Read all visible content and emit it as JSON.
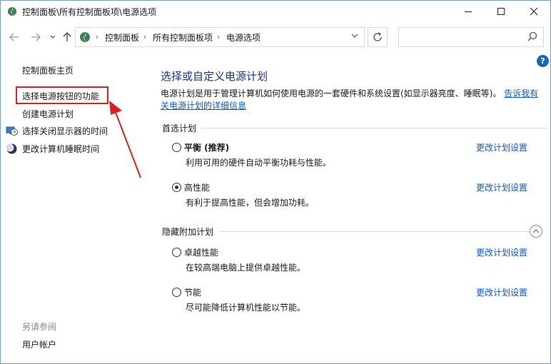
{
  "window": {
    "title": "控制面板\\所有控制面板项\\电源选项"
  },
  "address": {
    "crumbs": [
      "控制面板",
      "所有控制面板项",
      "电源选项"
    ],
    "search_placeholder": ""
  },
  "sidebar": {
    "home": "控制面板主页",
    "links": [
      "选择电源按钮的功能",
      "创建电源计划",
      "选择关闭显示器的时间",
      "更改计算机睡眠时间"
    ],
    "see_also_heading": "另请参阅",
    "see_also_links": [
      "用户帐户"
    ]
  },
  "main": {
    "title": "选择或自定义电源计划",
    "description": "电源计划是用于管理计算机如何使用电源的一套硬件和系统设置(如显示器亮度、睡眠等)。",
    "description_link": "告诉我有关电源计划的详细信息",
    "preferred_heading": "首选计划",
    "hidden_heading": "隐藏附加计划",
    "change_link": "更改计划设置",
    "plans": [
      {
        "name": "平衡 (推荐)",
        "desc": "利用可用的硬件自动平衡功耗与性能。",
        "selected": false
      },
      {
        "name": "高性能",
        "desc": "有利于提高性能，但会增加功耗。",
        "selected": true
      },
      {
        "name": "卓越性能",
        "desc": "在较高端电脑上提供卓越性能。",
        "selected": false
      },
      {
        "name": "节能",
        "desc": "尽可能降低计算机性能以节能。",
        "selected": false
      }
    ]
  },
  "colors": {
    "title_blue": "#1e3287",
    "link_blue": "#0a5bc4",
    "highlight_red": "#e02020"
  }
}
